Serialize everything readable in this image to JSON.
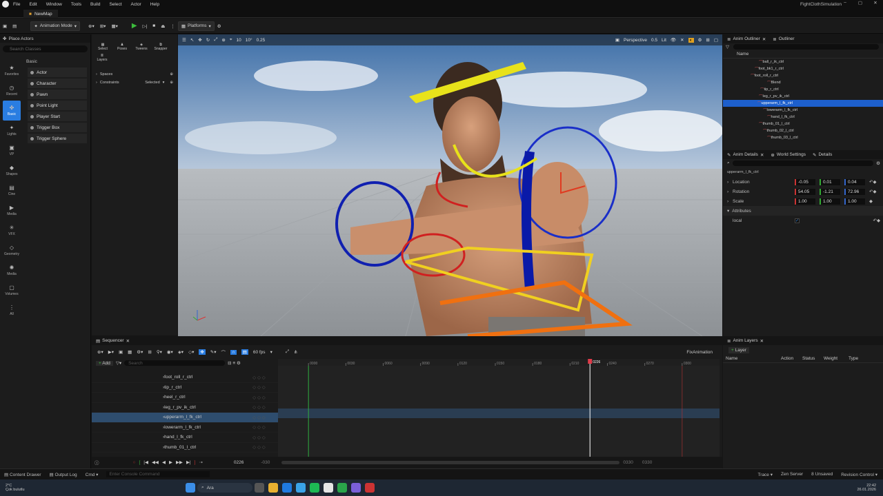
{
  "app": {
    "menu": [
      "File",
      "Edit",
      "Window",
      "Tools",
      "Build",
      "Select",
      "Actor",
      "Help"
    ],
    "title": "FightClothSimulation",
    "tab": "NewMap"
  },
  "toolbar": {
    "mode": "Animation Mode",
    "platforms": "Platforms"
  },
  "place": {
    "title": "Place Actors",
    "search_placeholder": "Search Classes",
    "section": "Basic",
    "categories": [
      {
        "label": "Favorites",
        "icon": "★"
      },
      {
        "label": "Recent",
        "icon": "◷"
      },
      {
        "label": "Basic",
        "icon": "✤"
      },
      {
        "label": "Lights",
        "icon": "✦"
      },
      {
        "label": "VP",
        "icon": "▣"
      },
      {
        "label": "Shapes",
        "icon": "◆"
      },
      {
        "label": "Cine",
        "icon": "▤"
      },
      {
        "label": "Media",
        "icon": "▶"
      },
      {
        "label": "VFX",
        "icon": "✳"
      },
      {
        "label": "Geometry",
        "icon": "◇"
      },
      {
        "label": "Media",
        "icon": "✺"
      },
      {
        "label": "Volumes",
        "icon": "▢"
      },
      {
        "label": "All",
        "icon": "⋮"
      }
    ],
    "classes": [
      "Actor",
      "Character",
      "Pawn",
      "Point Light",
      "Player Start",
      "Trigger Box",
      "Trigger Sphere"
    ]
  },
  "animpanel": {
    "tools": [
      "Select",
      "Poses",
      "Tweens",
      "Snapper"
    ],
    "layers": "Layers",
    "spaces": "Spaces",
    "constraints": "Constraints",
    "selected": "Selected"
  },
  "viewport": {
    "perspective": "Perspective",
    "lit": "Lit",
    "snap1": "10",
    "snap2": "10°",
    "snap3": "0.25",
    "speed": "0.5"
  },
  "outliner": {
    "tab1": "Anim Outliner",
    "tab2": "Outliner",
    "col": "Name",
    "items": [
      "ball_r_ik_ctrl",
      "foot_bk1_r_ctrl",
      "foot_roll_r_ctrl",
      "Blend",
      "tip_r_ctrl",
      "leg_r_pv_ik_ctrl",
      "upperarm_l_fk_ctrl",
      "lowerarm_l_fk_ctrl",
      "hand_l_fk_ctrl",
      "thumb_01_l_ctrl",
      "thumb_02_l_ctrl",
      "thumb_03_l_ctrl"
    ]
  },
  "details": {
    "tab1": "Anim Details",
    "tab2": "World Settings",
    "tab3": "Details",
    "object": "upperarm_l_fk_ctrl",
    "location": {
      "label": "Location",
      "x": "-0.05",
      "y": "0.01",
      "z": "0.04"
    },
    "rotation": {
      "label": "Rotation",
      "x": "54.05",
      "y": "-1.21",
      "z": "72.96"
    },
    "scale": {
      "label": "Scale",
      "x": "1.00",
      "y": "1.00",
      "z": "1.00"
    },
    "attributes": "Attributes",
    "attr_name": "local"
  },
  "sequencer": {
    "tab": "Sequencer",
    "fps": "60 fps",
    "sequence": "FixAnimation",
    "add": "Add",
    "search_placeholder": "Search",
    "current_frame": "0226",
    "playhead_frame": 226,
    "range_start": -30,
    "range_end": 330,
    "ruler_labels": [
      "0000",
      "0030",
      "0060",
      "0090",
      "0120",
      "0150",
      "0180",
      "0210",
      "0240",
      "0270",
      "0300"
    ],
    "start_label": "-030",
    "end_label1": "0330",
    "end_label2": "0330",
    "tracks": [
      "foot_roll_r_ctrl",
      "tip_r_ctrl",
      "heel_r_ctrl",
      "leg_r_pv_ik_ctrl",
      "upperarm_l_fk_ctrl",
      "lowerarm_l_fk_ctrl",
      "hand_l_fk_ctrl",
      "thumb_01_l_ctrl"
    ]
  },
  "animlayers": {
    "tab": "Anim Layers",
    "add": "Layer",
    "cols": [
      "Name",
      "Action",
      "Status",
      "Weight",
      "Type"
    ]
  },
  "status": {
    "content_drawer": "Content Drawer",
    "output_log": "Output Log",
    "cmd": "Cmd",
    "console_placeholder": "Enter Console Command",
    "trace": "Trace",
    "zen": "Zen Server",
    "unsaved": "8 Unsaved",
    "revision": "Revision Control"
  },
  "taskbar": {
    "weather_temp": "2°C",
    "weather_desc": "Çok bulutlu",
    "search": "Ara",
    "time": "22:42",
    "date": "26.01.2026"
  },
  "colors": {
    "accent": "#1d5fcc",
    "play": "#3cbb3c",
    "playhead": "#e03c4a"
  }
}
